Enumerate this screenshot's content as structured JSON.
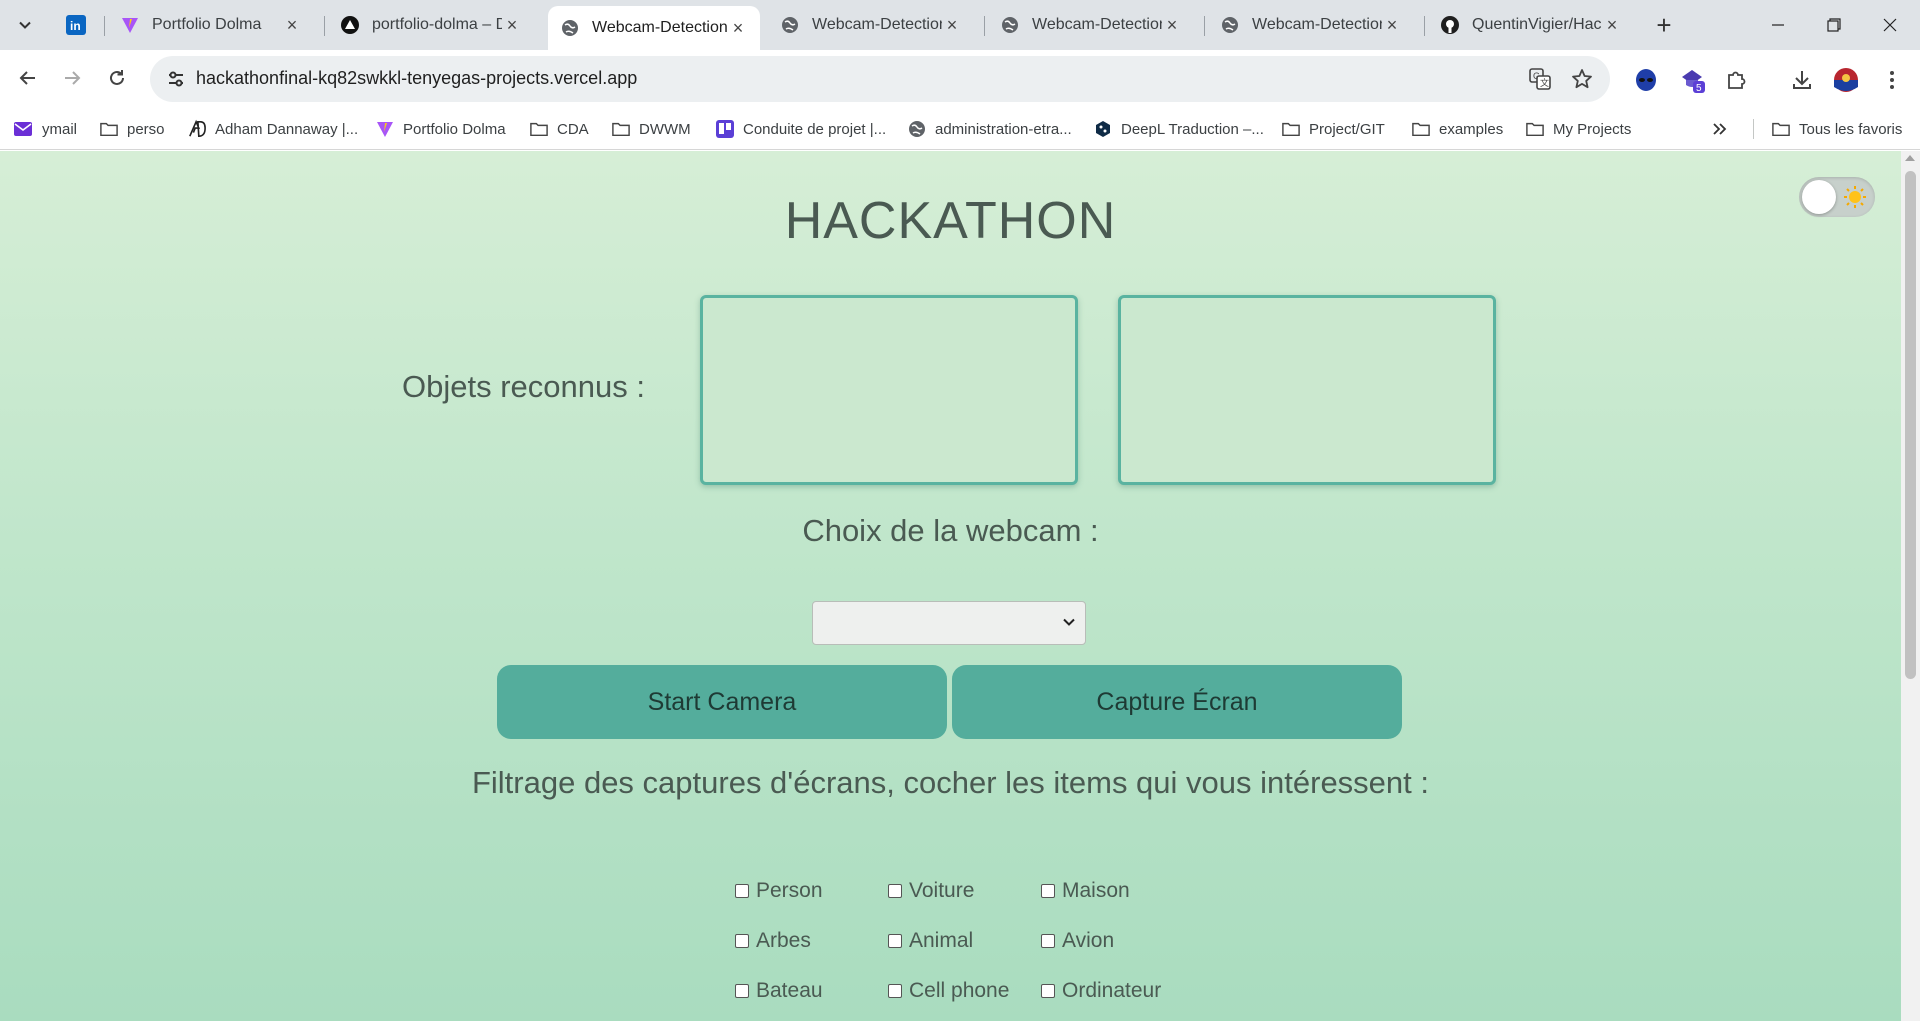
{
  "colors": {
    "accent": "#54ad9c",
    "box_border": "#5ab3a0",
    "text": "#4a5a52"
  },
  "browser": {
    "tabs": [
      {
        "title": "",
        "icon": "linkedin-icon"
      },
      {
        "title": "Portfolio Dolma",
        "icon": "vite-icon"
      },
      {
        "title": "portfolio-dolma – D",
        "icon": "vercel-icon"
      },
      {
        "title": "Webcam-Detection",
        "icon": "globe-icon",
        "active": true
      },
      {
        "title": "Webcam-Detection",
        "icon": "globe-icon"
      },
      {
        "title": "Webcam-Detection",
        "icon": "globe-icon"
      },
      {
        "title": "Webcam-Detection",
        "icon": "globe-icon"
      },
      {
        "title": "QuentinVigier/Hack",
        "icon": "github-icon"
      }
    ],
    "url": "hackathonfinal-kq82swkkl-tenyegas-projects.vercel.app",
    "extensions_badge": "5",
    "bookmarks": [
      {
        "label": "ymail",
        "icon": "mail-icon"
      },
      {
        "label": "perso",
        "icon": "folder-icon"
      },
      {
        "label": "Adham Dannaway |...",
        "icon": "ad-logo-icon"
      },
      {
        "label": "Portfolio Dolma",
        "icon": "vite-icon"
      },
      {
        "label": "CDA",
        "icon": "folder-icon"
      },
      {
        "label": "DWWM",
        "icon": "folder-icon"
      },
      {
        "label": "Conduite de projet |...",
        "icon": "trello-icon"
      },
      {
        "label": "administration-etra...",
        "icon": "globe-icon"
      },
      {
        "label": "DeepL Traduction –...",
        "icon": "deepl-icon"
      },
      {
        "label": "Project/GIT",
        "icon": "folder-icon"
      },
      {
        "label": "examples",
        "icon": "folder-icon"
      },
      {
        "label": "My Projects",
        "icon": "folder-icon"
      }
    ],
    "all_bookmarks": "Tous les favoris"
  },
  "page": {
    "title": "HACKATHON",
    "objects_label": "Objets reconnus :",
    "webcam_label": "Choix de la webcam :",
    "webcam_selected": "",
    "start_button": "Start Camera",
    "capture_button": "Capture Écran",
    "filter_label": "Filtrage des captures d'écrans, cocher les items qui vous intéressent :",
    "filters": [
      {
        "label": "Person",
        "checked": false
      },
      {
        "label": "Voiture",
        "checked": false
      },
      {
        "label": "Maison",
        "checked": false
      },
      {
        "label": "Arbes",
        "checked": false
      },
      {
        "label": "Animal",
        "checked": false
      },
      {
        "label": "Avion",
        "checked": false
      },
      {
        "label": "Bateau",
        "checked": false
      },
      {
        "label": "Cell phone",
        "checked": false
      },
      {
        "label": "Ordinateur",
        "checked": false
      }
    ]
  }
}
